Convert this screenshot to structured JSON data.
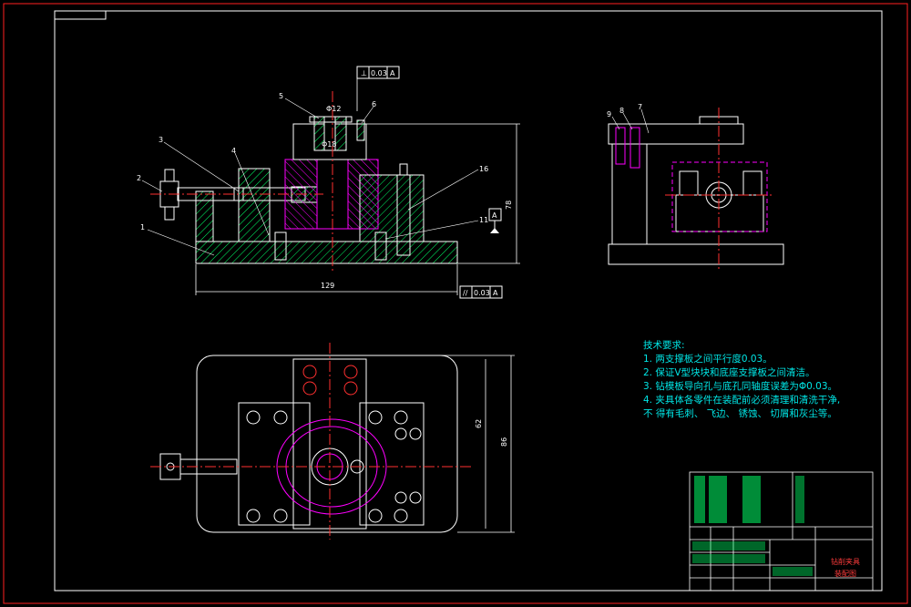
{
  "drawing": {
    "tech_requirements": {
      "heading": "技术要求:",
      "items": [
        "1. 两支撑板之间平行度0.03。",
        "2. 保证V型块块和底座支撑板之间清洁。",
        "3. 钻模板导向孔与底孔同轴度误差为Φ0.03。",
        "4. 夹具体各零件在装配前必须清理和清洗干净,",
        "不 得有毛刺、 飞边、 锈蚀、 切屑和灰尘等。"
      ]
    },
    "part_numbers": [
      "1",
      "2",
      "3",
      "4",
      "5",
      "6",
      "11",
      "16",
      "9",
      "8",
      "7"
    ],
    "dimensions": {
      "width_front": "129",
      "height_front": "78",
      "plan_h1": "62",
      "plan_h2": "86",
      "bore_top": "Φ12",
      "bore_mid": "Φ18"
    },
    "tolerances": {
      "perp": "0.03",
      "perp_datum": "A",
      "parallel": "0.03",
      "parallel_datum": "A",
      "datum_label": "A"
    },
    "title_block": {
      "name_line1": "钻削夹具",
      "name_line2": "装配图"
    },
    "colors": {
      "frame": "#ff2020",
      "outline": "#ffffff",
      "magenta": "#ff00ff",
      "hatch": "#00ff66",
      "cyan": "#00e5e5",
      "center": "#ff3030"
    }
  }
}
